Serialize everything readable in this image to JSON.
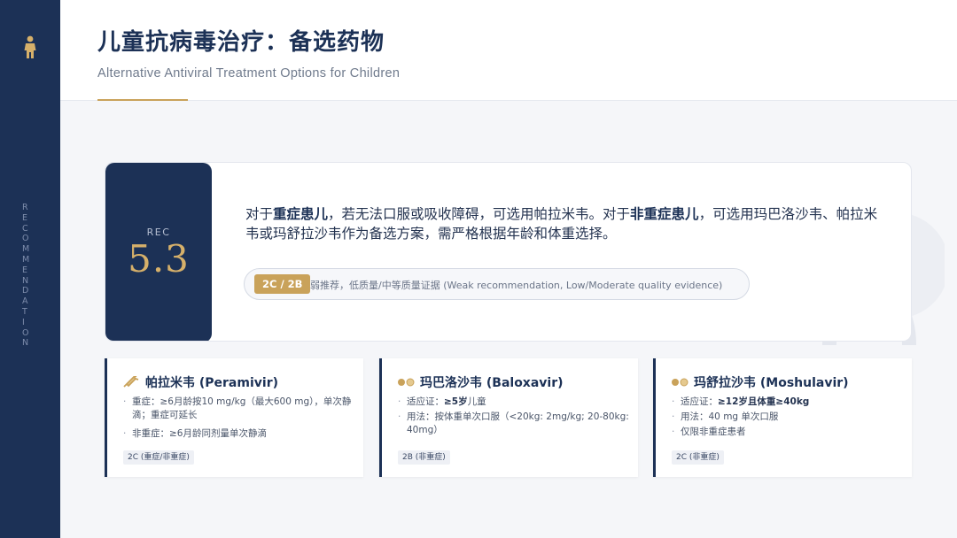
{
  "sidebar": {
    "vertical_label": [
      "R",
      "E",
      "C",
      "O",
      "M",
      "M",
      "E",
      "N",
      "D",
      "A",
      "T",
      "I",
      "O",
      "N"
    ]
  },
  "header": {
    "title": "儿童抗病毒治疗：备选药物",
    "subtitle": "Alternative Antiviral Treatment Options for Children"
  },
  "recommendation": {
    "label": "REC",
    "number": "5.3",
    "text_parts": [
      "对于",
      "重症患儿",
      "，若无法口服或吸收障碍，可选用帕拉米韦。对于",
      "非重症患儿",
      "，可选用玛巴洛沙韦、帕拉米韦或玛舒拉沙韦作为备选方案，需严格根据年龄和体重选择。"
    ],
    "grade_badge": "2C / 2B",
    "grade_text": "弱推荐，低质量/中等质量证据 (Weak recommendation, Low/Moderate quality evidence)"
  },
  "drugs": [
    {
      "icon": "syringe-icon",
      "title": "帕拉米韦 (Peramivir)",
      "items": [
        {
          "label": "重症：",
          "value": "≥6月龄按10 mg/kg（最大600 mg），单次静滴；重症可延长"
        },
        {
          "label": "非重症：",
          "value": "≥6月龄同剂量单次静滴"
        }
      ],
      "grade": "2C (重症/非重症)"
    },
    {
      "icon": "pills-icon",
      "title": "玛巴洛沙韦 (Baloxavir)",
      "items": [
        {
          "label": "适应证：",
          "value": "≥5岁",
          "value_rest": "儿童"
        },
        {
          "label": "用法：",
          "value": "按体重单次口服（<20kg: 2mg/kg; 20-80kg: 40mg）"
        }
      ],
      "grade": "2B (非重症)"
    },
    {
      "icon": "pills-icon",
      "title": "玛舒拉沙韦 (Moshulavir)",
      "items": [
        {
          "label": "适应证：",
          "value": "≥12岁且体重≥40kg"
        },
        {
          "label": "用法：",
          "value": "40 mg 单次口服"
        },
        {
          "label": "",
          "value": "仅限非重症患者"
        }
      ],
      "grade": "2C (非重症)"
    }
  ],
  "colors": {
    "navy": "#1c3156",
    "gold": "#c9a25a",
    "background": "#f5f6f9"
  }
}
